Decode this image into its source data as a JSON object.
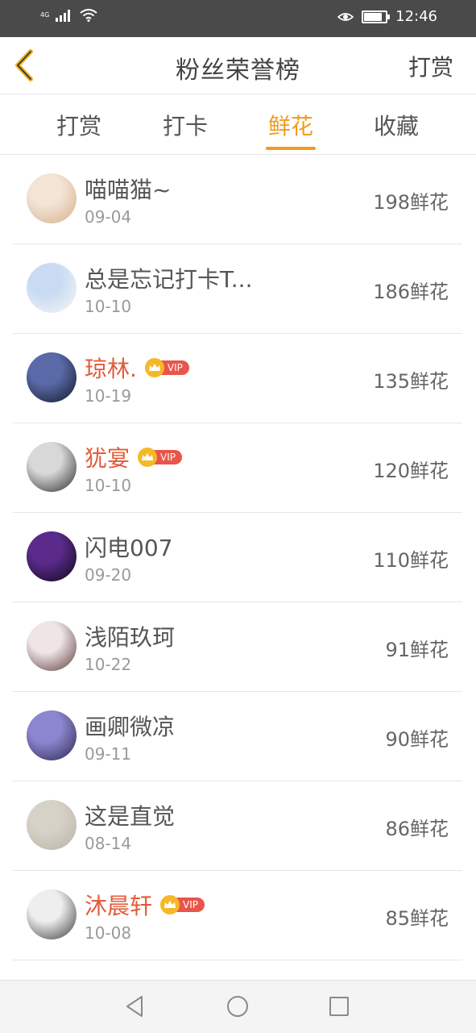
{
  "status_bar": {
    "network": "4G",
    "time": "12:46",
    "battery_level": 0.85
  },
  "header": {
    "title": "粉丝荣誉榜",
    "action_label": "打赏"
  },
  "tabs": [
    {
      "label": "打赏",
      "active": false
    },
    {
      "label": "打卡",
      "active": false
    },
    {
      "label": "鲜花",
      "active": true
    },
    {
      "label": "收藏",
      "active": false
    }
  ],
  "vip_label": "VIP",
  "fans": [
    {
      "name": "喵喵猫~",
      "date": "09-04",
      "count": "198鲜花",
      "vip": false,
      "avatar_colors": [
        "#f3e4d6",
        "#d6b08a"
      ]
    },
    {
      "name": "总是忘记打卡T...",
      "date": "10-10",
      "count": "186鲜花",
      "vip": false,
      "avatar_colors": [
        "#c9dbf2",
        "#f7f7f7"
      ]
    },
    {
      "name": "琼林.",
      "date": "10-19",
      "count": "135鲜花",
      "vip": true,
      "avatar_colors": [
        "#5a6aa8",
        "#141826"
      ]
    },
    {
      "name": "犹宴",
      "date": "10-10",
      "count": "120鲜花",
      "vip": true,
      "avatar_colors": [
        "#d8d8d8",
        "#2b2b2b"
      ]
    },
    {
      "name": "闪电007",
      "date": "09-20",
      "count": "110鲜花",
      "vip": false,
      "avatar_colors": [
        "#5b2b8c",
        "#0b0714"
      ]
    },
    {
      "name": "浅陌玖珂",
      "date": "10-22",
      "count": "91鲜花",
      "vip": false,
      "avatar_colors": [
        "#efe4e6",
        "#5a3b3a"
      ]
    },
    {
      "name": "画卿微凉",
      "date": "09-11",
      "count": "90鲜花",
      "vip": false,
      "avatar_colors": [
        "#8c86d0",
        "#2c264e"
      ]
    },
    {
      "name": "这是直觉",
      "date": "08-14",
      "count": "86鲜花",
      "vip": false,
      "avatar_colors": [
        "#d7d2c8",
        "#b8b2a6"
      ]
    },
    {
      "name": "沐晨轩",
      "date": "10-08",
      "count": "85鲜花",
      "vip": true,
      "avatar_colors": [
        "#eeeeee",
        "#3a3a3a"
      ]
    }
  ]
}
